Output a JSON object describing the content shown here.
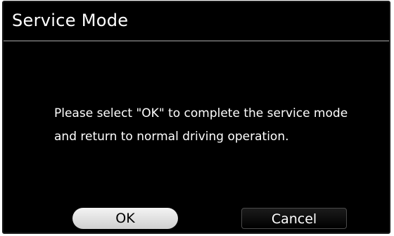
{
  "window": {
    "title": "Service Mode"
  },
  "dialog": {
    "message_line1": "Please select \"OK\" to complete the service mode",
    "message_line2": "and return to normal driving operation."
  },
  "buttons": {
    "ok_label": "OK",
    "cancel_label": "Cancel"
  },
  "colors": {
    "background": "#000000",
    "text": "#ffffff",
    "ok_button": "#e6e6e6",
    "divider": "#5a5a5a"
  }
}
